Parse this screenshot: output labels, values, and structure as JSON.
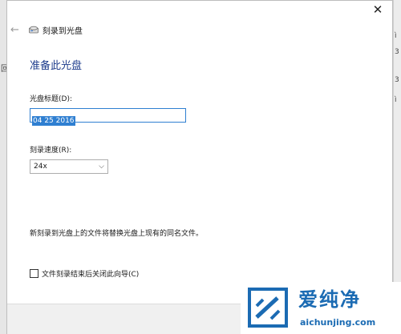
{
  "window": {
    "close_label": "✕",
    "back_label": "←",
    "nav_title": "刻录到光盘"
  },
  "heading": "准备此光盘",
  "disc_title": {
    "label": "光盘标题(D):",
    "value": "04 25 2016"
  },
  "speed": {
    "label": "刻录速度(R):",
    "selected": "24x",
    "chevron": "⌵"
  },
  "note": "新刻录到光盘上的文件将替换光盘上现有的同名文件。",
  "close_wizard_checkbox": {
    "label": "文件刻录结束后关闭此向导(C)",
    "checked": false
  },
  "background_fragments": {
    "left": "回",
    "right": [
      "ì",
      "3",
      "3",
      "ì"
    ]
  },
  "watermark": {
    "title": "爱纯净",
    "url": "aichunjing.com",
    "color": "#1b6bb3"
  }
}
